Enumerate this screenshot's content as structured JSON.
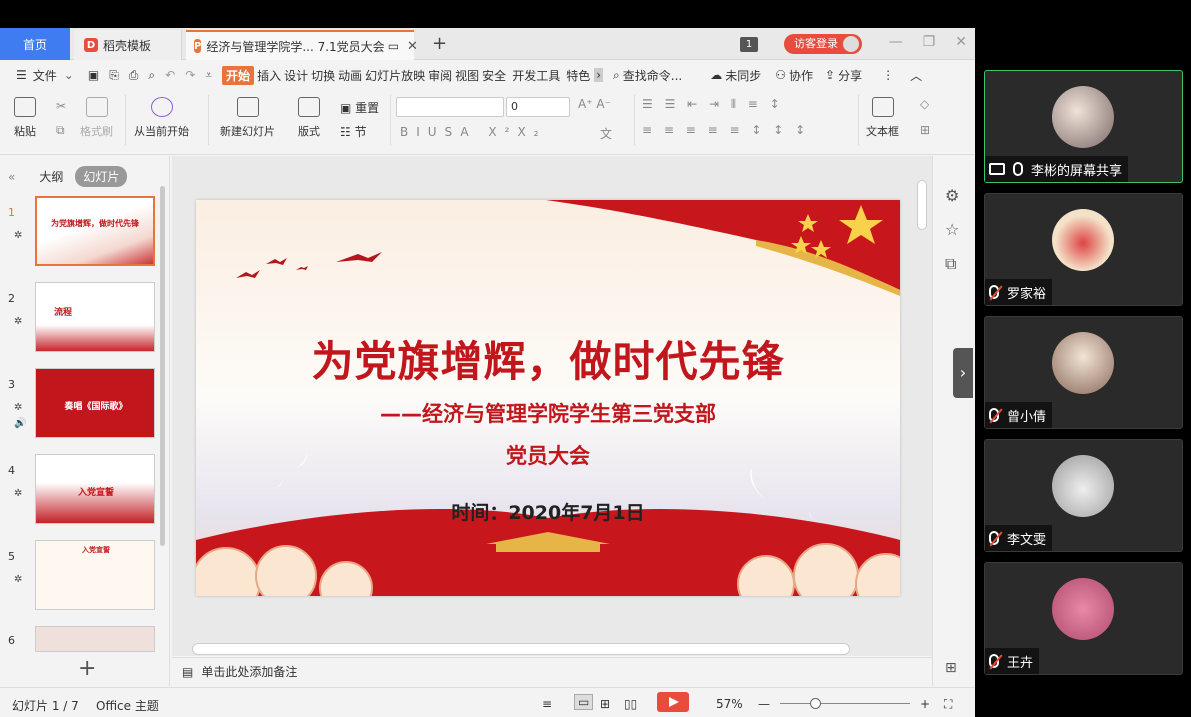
{
  "tabs": {
    "home": "首页",
    "daoke": "稻壳模板",
    "doc": "经济与管理学院学... 7.1党员大会",
    "badge": "1",
    "login": "访客登录"
  },
  "menu": {
    "file": "文件",
    "active": "开始",
    "items": [
      "插入",
      "设计",
      "切换",
      "动画",
      "幻灯片放映",
      "审阅",
      "视图",
      "安全",
      "开发工具",
      "特色"
    ],
    "search": "查找命令...",
    "sync": "未同步",
    "collab": "协作",
    "share": "分享"
  },
  "ribbon": {
    "paste": "粘贴",
    "format_painter": "格式刷",
    "from_current": "从当前开始",
    "new_slide": "新建幻灯片",
    "layout": "版式",
    "reset": "重置",
    "section": "节",
    "font_size": "0",
    "textbox": "文本框"
  },
  "leftpanel": {
    "outline": "大纲",
    "slides": "幻灯片",
    "thumbs": [
      {
        "num": "1",
        "title": "为党旗增辉，做时代先锋"
      },
      {
        "num": "2",
        "title": "流程"
      },
      {
        "num": "3",
        "title": "奏唱《国际歌》"
      },
      {
        "num": "4",
        "title": "入党宣誓"
      },
      {
        "num": "5",
        "title": "入党宣誓"
      },
      {
        "num": "6",
        "title": ""
      }
    ]
  },
  "slide": {
    "title": "为党旗增辉，做时代先锋",
    "subtitle": "——经济与管理学院学生第三党支部",
    "subtitle2": "党员大会",
    "date": "时间：2020年7月1日"
  },
  "notes": {
    "placeholder": "单击此处添加备注"
  },
  "status": {
    "slide_count": "幻灯片 1 / 7",
    "theme": "Office 主题",
    "zoom": "57%"
  },
  "meeting": {
    "participants": [
      {
        "name": "李彬的屏幕共享",
        "sharing": true
      },
      {
        "name": "罗家裕",
        "sharing": false
      },
      {
        "name": "曾小倩",
        "sharing": false
      },
      {
        "name": "李文雯",
        "sharing": false
      },
      {
        "name": "王卉",
        "sharing": false
      }
    ]
  },
  "colors": {
    "accent": "#e8743b",
    "brand_blue": "#3f7cf2",
    "slide_red": "#c0161c",
    "active_speaker": "#3ec26a"
  }
}
